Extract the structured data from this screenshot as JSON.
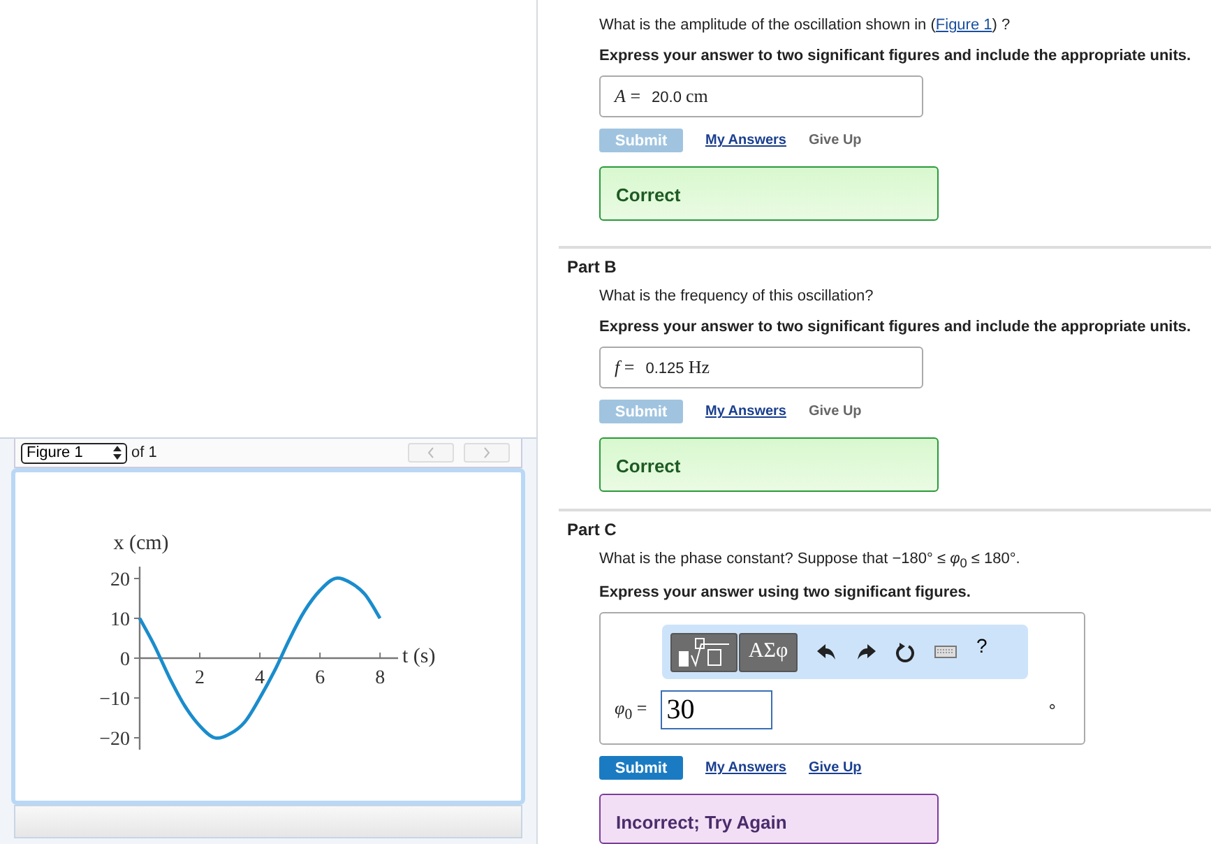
{
  "figure_panel": {
    "selector": "Figure 1",
    "of_label": "of 1",
    "chart_data": {
      "type": "line",
      "xlabel": "t (s)",
      "ylabel": "x (cm)",
      "x": [
        0,
        0.5,
        1,
        1.5,
        2,
        2.5,
        3,
        3.5,
        4,
        4.5,
        5,
        5.5,
        6,
        6.5,
        7,
        7.5,
        8
      ],
      "series": [
        {
          "color": "#1a8ccc",
          "values": [
            10,
            3,
            -5,
            -12,
            -17,
            -20,
            -19,
            -16,
            -10,
            -3,
            5,
            12,
            17,
            20,
            19,
            16,
            10
          ]
        }
      ],
      "xlim": [
        0,
        8.6
      ],
      "ylim": [
        -23,
        23
      ],
      "xticks": [
        2,
        4,
        6,
        8
      ],
      "yticks": [
        -20,
        -10,
        0,
        10,
        20
      ]
    }
  },
  "parts": [
    {
      "question_before": "What is the amplitude of the oscillation shown in (",
      "question_link": "Figure 1",
      "question_after": ") ?",
      "instruction": "Express your answer to two significant figures and include the appropriate units.",
      "answer": {
        "kind": "units",
        "label": "*A* =",
        "value": "20.0",
        "unit": "cm"
      },
      "submit": {
        "label": "Submit",
        "disabled": true
      },
      "links": [
        {
          "label": "My Answers",
          "disabled": false
        },
        {
          "label": "Give Up",
          "disabled": true
        }
      ],
      "feedback": {
        "kind": "correct",
        "text": "Correct"
      }
    },
    {
      "heading": "Part B",
      "question_before": "What is the frequency of this oscillation?",
      "instruction": "Express your answer to two significant figures and include the appropriate units.",
      "answer": {
        "kind": "units",
        "label": "*f* =",
        "value": "0.125",
        "unit": "Hz"
      },
      "submit": {
        "label": "Submit",
        "disabled": true
      },
      "links": [
        {
          "label": "My Answers",
          "disabled": false
        },
        {
          "label": "Give Up",
          "disabled": true
        }
      ],
      "feedback": {
        "kind": "correct",
        "text": "Correct"
      }
    },
    {
      "heading": "Part C",
      "question_before": "What is the phase constant? Suppose that −180° ≤ *φ*$_{0}$ ≤ 180°.",
      "instruction": "Express your answer using two significant figures.",
      "answer": {
        "kind": "math",
        "label": "*φ*$_{0}$ =",
        "value": "30",
        "unit": "°",
        "toolbar": [
          {
            "kind": "template"
          },
          {
            "kind": "symbols",
            "label": "ΑΣφ"
          },
          {
            "kind": "undo"
          },
          {
            "kind": "redo"
          },
          {
            "kind": "reset"
          },
          {
            "kind": "keyboard"
          },
          {
            "kind": "help",
            "label": "?"
          }
        ]
      },
      "submit": {
        "label": "Submit",
        "disabled": false
      },
      "links": [
        {
          "label": "My Answers",
          "disabled": false
        },
        {
          "label": "Give Up",
          "disabled": false
        }
      ],
      "feedback": {
        "kind": "incorrect",
        "text": "Incorrect; Try Again"
      }
    }
  ]
}
